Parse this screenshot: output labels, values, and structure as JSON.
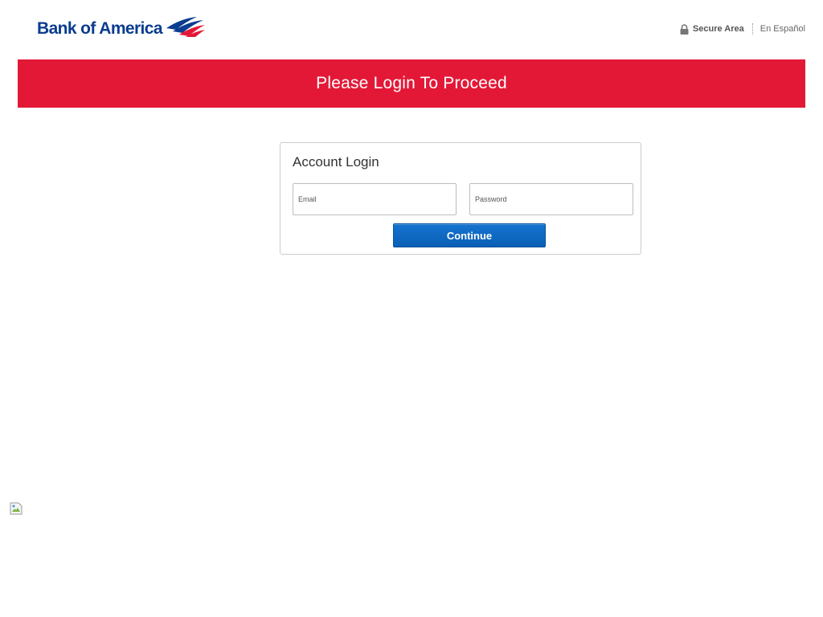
{
  "header": {
    "logo_text": "Bank of America",
    "secure_label": "Secure Area",
    "secure_icon": "lock-icon",
    "language_link": "En Español"
  },
  "banner": {
    "title": "Please Login To Proceed",
    "color": "#e31837"
  },
  "login": {
    "title": "Account Login",
    "email": {
      "placeholder": "Email",
      "value": ""
    },
    "password": {
      "placeholder": "Password",
      "value": ""
    },
    "continue_label": "Continue"
  },
  "colors": {
    "brand_blue": "#0a3c8f",
    "brand_red": "#e31837",
    "button_blue": "#0a5fb5"
  }
}
